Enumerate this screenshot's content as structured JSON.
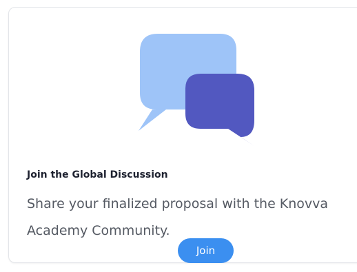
{
  "card": {
    "icon": "chat-bubbles-icon",
    "title": "Join the Global Discussion",
    "description": "Share your finalized proposal with the Knovva Academy Community.",
    "join_label": "Join"
  },
  "colors": {
    "bubble_back": "#9ec4f8",
    "bubble_front": "#5258c0",
    "button": "#3b8ff0",
    "button_text": "#ffffff",
    "title_text": "#1e2230",
    "body_text": "#555a63"
  }
}
